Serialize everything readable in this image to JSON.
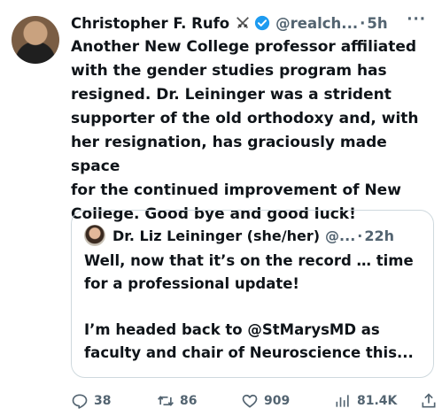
{
  "tweet": {
    "author": "Christopher F. Rufo",
    "handle": "@realch...",
    "separator": "·",
    "time": "5h",
    "more": "···",
    "text": "Another New College professor affiliated\nwith the gender studies program has\nresigned. Dr. Leininger was a strident\nsupporter of the old orthodoxy and, with\nher resignation, has graciously made space\nfor the continued improvement of New\nCollege. Good bye and good luck!"
  },
  "quote": {
    "author": "Dr. Liz Leininger (she/her)",
    "handle": "@...",
    "separator": "·",
    "time": "22h",
    "text": "Well, now that it’s on the record … time\nfor a professional update!\n\nI’m headed back to @StMarysMD as\nfaculty and chair of Neuroscience this..."
  },
  "actions": {
    "replies": "38",
    "reposts": "86",
    "likes": "909",
    "views": "81.4K"
  },
  "icons": [
    "crossed-swords-icon",
    "verified-badge-icon",
    "reply-icon",
    "repost-icon",
    "like-icon",
    "views-icon",
    "share-icon"
  ],
  "colors": {
    "text": "#0f1419",
    "muted": "#536471",
    "verified": "#1d9bf0",
    "border": "#cfd9de"
  }
}
